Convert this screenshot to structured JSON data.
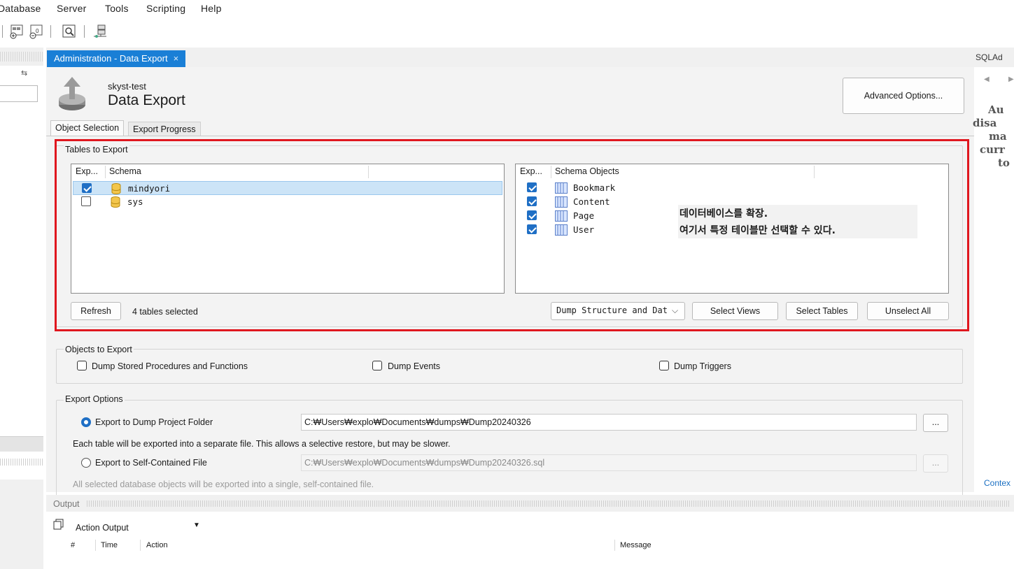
{
  "menu": {
    "items": [
      "Database",
      "Server",
      "Tools",
      "Scripting",
      "Help"
    ]
  },
  "toolbar": {
    "icons": [
      "manage-connections-icon",
      "new-schema-icon",
      "schema-inspector-icon",
      "search-table-data-icon",
      "reconnect-icon"
    ]
  },
  "tab": {
    "title": "Administration - Data Export",
    "close": "×"
  },
  "header": {
    "connection": "skyst-test",
    "title": "Data Export",
    "advanced_button": "Advanced Options..."
  },
  "inner_tabs": [
    "Object Selection",
    "Export Progress"
  ],
  "tables_to_export": {
    "label": "Tables to Export",
    "schema_list": {
      "columns": [
        "Exp...",
        "Schema"
      ],
      "rows": [
        {
          "checked": true,
          "name": "mindyori",
          "selected": true
        },
        {
          "checked": false,
          "name": "sys",
          "selected": false
        }
      ]
    },
    "object_list": {
      "columns": [
        "Exp...",
        "Schema Objects"
      ],
      "rows": [
        {
          "checked": true,
          "name": "Bookmark"
        },
        {
          "checked": true,
          "name": "Content"
        },
        {
          "checked": true,
          "name": "Page"
        },
        {
          "checked": true,
          "name": "User"
        }
      ]
    },
    "annotation": {
      "line1": "데이터베이스를 확장.",
      "line2": "여기서 특정 테이블만 선택할 수 있다."
    },
    "refresh_button": "Refresh",
    "selected_count": "4 tables selected",
    "dump_mode": "Dump Structure and Dat",
    "select_views_button": "Select Views",
    "select_tables_button": "Select Tables",
    "unselect_all_button": "Unselect All",
    "annotation_border_color": "#e0171f"
  },
  "objects_to_export": {
    "label": "Objects to Export",
    "options": [
      {
        "label": "Dump Stored Procedures and Functions",
        "checked": false
      },
      {
        "label": "Dump Events",
        "checked": false
      },
      {
        "label": "Dump Triggers",
        "checked": false
      }
    ]
  },
  "export_options": {
    "label": "Export Options",
    "folder_option": {
      "label": "Export to Dump Project Folder",
      "selected": true,
      "path": "C:₩Users₩explo₩Documents₩dumps₩Dump20240326",
      "browse": "...",
      "description": "Each table will be exported into a separate file. This allows a selective restore, but may be slower."
    },
    "file_option": {
      "label": "Export to Self-Contained File",
      "selected": false,
      "path": "C:₩Users₩explo₩Documents₩dumps₩Dump20240326.sql",
      "browse": "...",
      "description": "All selected database objects will be exported into a single, self-contained file."
    }
  },
  "right_panel": {
    "title": "SQLAd",
    "text_lines": [
      "Au",
      "disa",
      "ma",
      "curr",
      "to"
    ],
    "footer": "Contex"
  },
  "output": {
    "label": "Output",
    "selector": "Action Output",
    "columns": [
      "#",
      "Time",
      "Action",
      "Message"
    ]
  },
  "colors": {
    "accent": "#1a7fd6",
    "checkbox": "#1f6fc5",
    "selection": "#cce4f7"
  }
}
